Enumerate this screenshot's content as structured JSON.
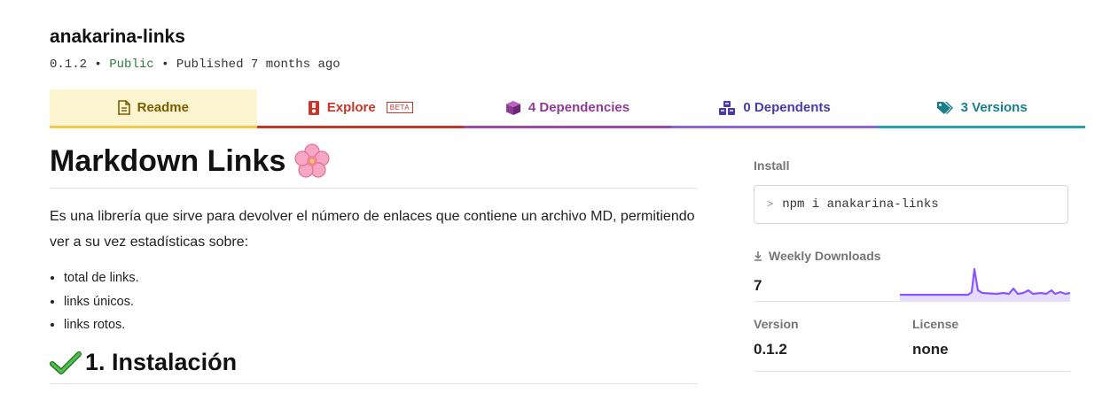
{
  "package": {
    "name": "anakarina-links",
    "version": "0.1.2",
    "visibility": "Public",
    "published": "Published 7 months ago",
    "separator": "•"
  },
  "tabs": [
    {
      "label": "Readme",
      "icon": "file-text-icon",
      "color": "#7a5c00"
    },
    {
      "label": "Explore",
      "icon": "flask-icon",
      "badge": "BETA",
      "color": "#c0392b"
    },
    {
      "label": "4 Dependencies",
      "icon": "cube-icon",
      "color": "#8e3b96"
    },
    {
      "label": "0 Dependents",
      "icon": "cubes-icon",
      "color": "#4b3aa6"
    },
    {
      "label": "3 Versions",
      "icon": "tags-icon",
      "color": "#1a7e8a"
    }
  ],
  "readme": {
    "title": "Markdown Links",
    "title_emoji": "cherry-blossom-icon",
    "intro": "Es una librería que sirve para devolver el número de enlaces que contiene un archivo MD, permitiendo ver a su vez estadísticas sobre:",
    "bullets": [
      "total de links.",
      "links únicos.",
      "links rotos."
    ],
    "section_title": "1. Instalación",
    "section_icon": "check-mark-icon"
  },
  "sidebar": {
    "install_label": "Install",
    "install_prompt": ">",
    "install_command": "npm i anakarina-links",
    "weekly_downloads_label": "Weekly Downloads",
    "weekly_downloads_icon": "download-icon",
    "weekly_downloads_value": "7",
    "sparkline_color": "#8956ff",
    "version_label": "Version",
    "version_value": "0.1.2",
    "license_label": "License",
    "license_value": "none"
  }
}
